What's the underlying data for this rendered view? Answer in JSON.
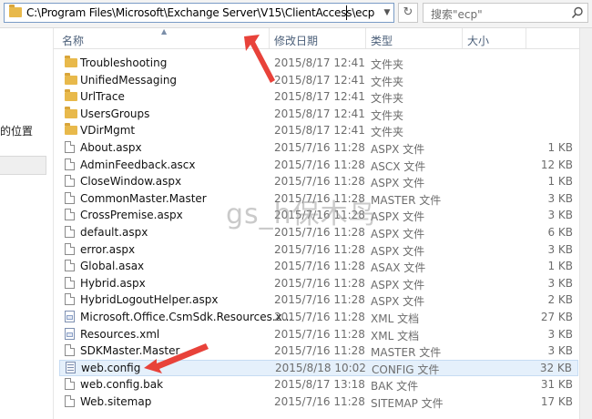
{
  "address_bar": {
    "path": "C:\\Program Files\\Microsoft\\Exchange Server\\V15\\ClientAccess\\ecp"
  },
  "search": {
    "placeholder": "搜索\"ecp\""
  },
  "nav_pane": {
    "location_label": "的位置"
  },
  "columns": {
    "name": "名称",
    "date": "修改日期",
    "type": "类型",
    "size": "大小"
  },
  "files": [
    {
      "name": "Troubleshooting",
      "date": "2015/8/17 12:41",
      "type": "文件夹",
      "size": "",
      "icon": "folder-icon"
    },
    {
      "name": "UnifiedMessaging",
      "date": "2015/8/17 12:41",
      "type": "文件夹",
      "size": "",
      "icon": "folder-icon"
    },
    {
      "name": "UrlTrace",
      "date": "2015/8/17 12:41",
      "type": "文件夹",
      "size": "",
      "icon": "folder-icon"
    },
    {
      "name": "UsersGroups",
      "date": "2015/8/17 12:41",
      "type": "文件夹",
      "size": "",
      "icon": "folder-icon"
    },
    {
      "name": "VDirMgmt",
      "date": "2015/8/17 12:41",
      "type": "文件夹",
      "size": "",
      "icon": "folder-icon"
    },
    {
      "name": "About.aspx",
      "date": "2015/7/16 11:28",
      "type": "ASPX 文件",
      "size": "1 KB",
      "icon": "file-icon"
    },
    {
      "name": "AdminFeedback.ascx",
      "date": "2015/7/16 11:28",
      "type": "ASCX 文件",
      "size": "12 KB",
      "icon": "file-icon"
    },
    {
      "name": "CloseWindow.aspx",
      "date": "2015/7/16 11:28",
      "type": "ASPX 文件",
      "size": "1 KB",
      "icon": "file-icon"
    },
    {
      "name": "CommonMaster.Master",
      "date": "2015/7/16 11:28",
      "type": "MASTER 文件",
      "size": "3 KB",
      "icon": "file-icon"
    },
    {
      "name": "CrossPremise.aspx",
      "date": "2015/7/16 11:28",
      "type": "ASPX 文件",
      "size": "3 KB",
      "icon": "file-icon"
    },
    {
      "name": "default.aspx",
      "date": "2015/7/16 11:28",
      "type": "ASPX 文件",
      "size": "6 KB",
      "icon": "file-icon"
    },
    {
      "name": "error.aspx",
      "date": "2015/7/16 11:28",
      "type": "ASPX 文件",
      "size": "3 KB",
      "icon": "file-icon"
    },
    {
      "name": "Global.asax",
      "date": "2015/7/16 11:28",
      "type": "ASAX 文件",
      "size": "1 KB",
      "icon": "file-icon"
    },
    {
      "name": "Hybrid.aspx",
      "date": "2015/7/16 11:28",
      "type": "ASPX 文件",
      "size": "3 KB",
      "icon": "file-icon"
    },
    {
      "name": "HybridLogoutHelper.aspx",
      "date": "2015/7/16 11:28",
      "type": "ASPX 文件",
      "size": "2 KB",
      "icon": "file-icon"
    },
    {
      "name": "Microsoft.Office.CsmSdk.Resources.x...",
      "date": "2015/7/16 11:28",
      "type": "XML 文档",
      "size": "27 KB",
      "icon": "xml-file-icon"
    },
    {
      "name": "Resources.xml",
      "date": "2015/7/16 11:28",
      "type": "XML 文档",
      "size": "3 KB",
      "icon": "xml-file-icon"
    },
    {
      "name": "SDKMaster.Master",
      "date": "2015/7/16 11:28",
      "type": "MASTER 文件",
      "size": "3 KB",
      "icon": "file-icon"
    },
    {
      "name": "web.config",
      "date": "2015/8/18 10:02",
      "type": "CONFIG 文件",
      "size": "32 KB",
      "icon": "config-file-icon",
      "selected": true
    },
    {
      "name": "web.config.bak",
      "date": "2015/8/17 13:18",
      "type": "BAK 文件",
      "size": "31 KB",
      "icon": "file-icon"
    },
    {
      "name": "Web.sitemap",
      "date": "2015/7/16 11:28",
      "type": "SITEMAP 文件",
      "size": "17 KB",
      "icon": "file-icon"
    }
  ],
  "watermark": "gs_h保木鸟",
  "colors": {
    "arrow": "#e8423a",
    "selection": "#e5f0fb",
    "folder": "#e8b94b",
    "header_text": "#4c607a"
  }
}
